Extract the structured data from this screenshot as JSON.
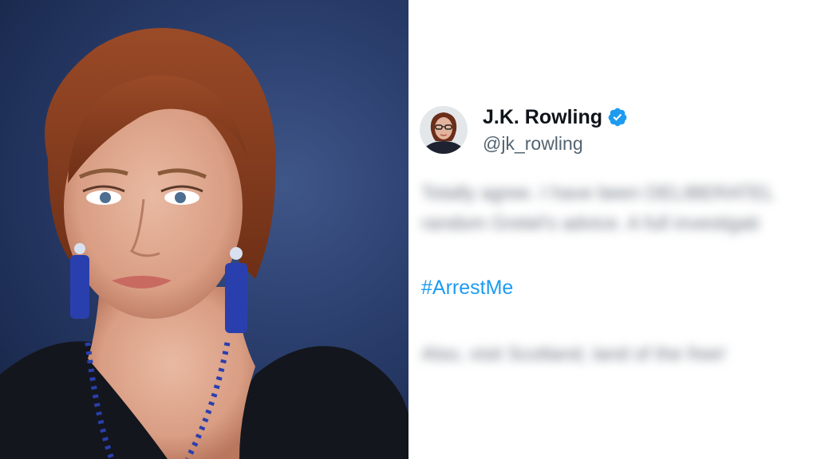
{
  "tweet": {
    "display_name": "J.K. Rowling",
    "handle": "@jk_rowling",
    "verified": true,
    "hashtag": "#ArrestMe",
    "blurred_paragraph_1": [
      "Totally agree. I have been DELIBERATEL",
      "random Gretel's advice. A full investigati"
    ],
    "blurred_paragraph_2": "Also, visit Scotland, land of the free!"
  },
  "colors": {
    "hashtag": "#1d9bf0",
    "verified_badge": "#1d9bf0",
    "handle": "#536471",
    "display_name": "#0f1419",
    "photo_background": "#2b3f6e"
  },
  "icons": {
    "verified": "verified-badge-icon"
  }
}
